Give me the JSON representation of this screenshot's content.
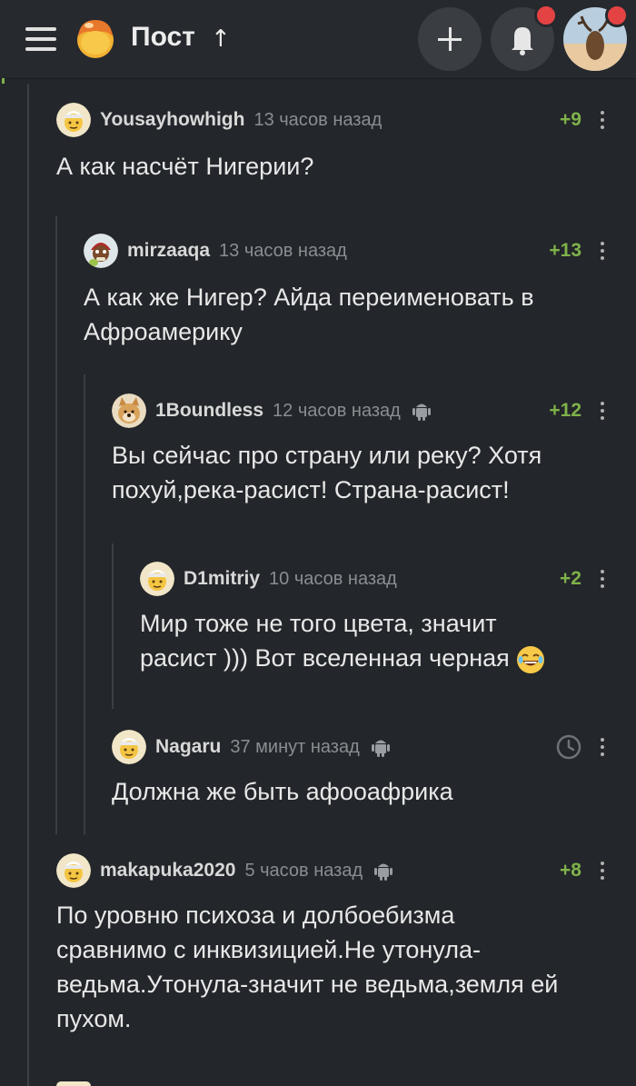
{
  "header": {
    "title": "Пост",
    "up_arrow": "↑",
    "icons": [
      "menu-icon",
      "logo-icon",
      "plus-icon",
      "bell-icon",
      "avatar"
    ]
  },
  "colors": {
    "background": "#23262a",
    "rating_positive": "#7fb24a",
    "notification": "#e44343"
  },
  "comments": [
    {
      "author": "Yousayhowhigh",
      "time": "13 часов назад",
      "rating": "+9",
      "text": "А как насчёт Нигерии?"
    },
    {
      "author": "mirzaaqa",
      "time": "13 часов назад",
      "rating": "+13",
      "text_lines": [
        "А как же Нигер? Айда переименовать в",
        "Афроамерику"
      ]
    },
    {
      "author": "1Boundless",
      "time": "12 часов назад",
      "device": "android-icon",
      "rating": "+12",
      "text_lines": [
        "Вы сейчас про страну или реку? Хотя",
        "похуй,река-расист! Страна-расист!"
      ]
    },
    {
      "author": "D1mitriy",
      "time": "10 часов назад",
      "rating": "+2",
      "text_lines": [
        "Мир тоже не того цвета, значит",
        "расист ))) Вот вселенная черная"
      ],
      "emoji": "laughing-emoji"
    },
    {
      "author": "Nagaru",
      "time": "37 минут назад",
      "device": "android-icon",
      "rating_icon": "clock-icon",
      "text": "Должна же быть афооафрика"
    },
    {
      "author": "makapuka2020",
      "time": "5 часов назад",
      "device": "android-icon",
      "rating": "+8",
      "text_lines": [
        "По уровню психоза и долбоебизма",
        "сравнимо с инквизицией.Не утонула-",
        "ведьма.Утонула-значит не ведьма,земля ей",
        "пухом."
      ]
    }
  ]
}
